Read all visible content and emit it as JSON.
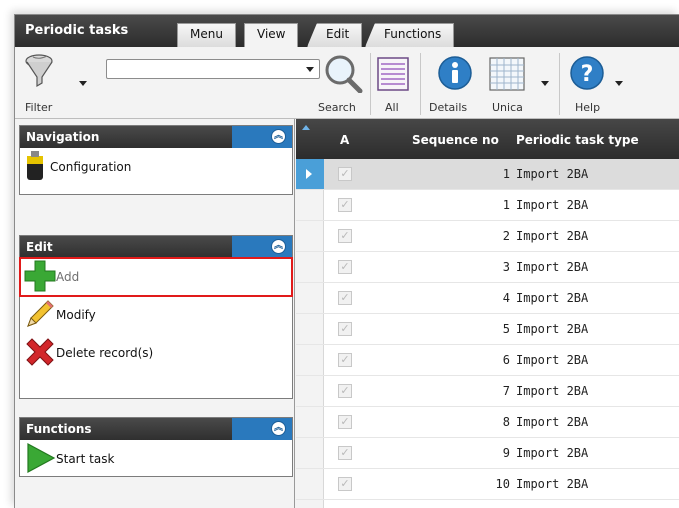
{
  "app_title": "Periodic tasks",
  "tabs": [
    {
      "label": "Menu",
      "active": false
    },
    {
      "label": "View",
      "active": true
    },
    {
      "label": "Edit",
      "active": false
    },
    {
      "label": "Functions",
      "active": false
    }
  ],
  "ribbon": {
    "filter_label": "Filter",
    "search_value": "",
    "search_label": "Search",
    "all_label": "All",
    "details_label": "Details",
    "unica_label": "Unica",
    "help_label": "Help"
  },
  "panels": {
    "navigation": {
      "title": "Navigation",
      "items": [
        {
          "label": "Configuration",
          "icon": "configuration-icon"
        }
      ]
    },
    "edit": {
      "title": "Edit",
      "items": [
        {
          "label": "Add",
          "icon": "add-icon"
        },
        {
          "label": "Modify",
          "icon": "pencil-icon"
        },
        {
          "label": "Delete record(s)",
          "icon": "delete-icon"
        }
      ]
    },
    "functions": {
      "title": "Functions",
      "items": [
        {
          "label": "Start task",
          "icon": "play-icon"
        }
      ]
    }
  },
  "grid": {
    "columns": [
      "A",
      "Sequence no",
      "Periodic task type"
    ],
    "rows": [
      {
        "seq": "1",
        "type": "Import 2BA"
      },
      {
        "seq": "1",
        "type": "Import 2BA"
      },
      {
        "seq": "2",
        "type": "Import 2BA"
      },
      {
        "seq": "3",
        "type": "Import 2BA"
      },
      {
        "seq": "4",
        "type": "Import 2BA"
      },
      {
        "seq": "5",
        "type": "Import 2BA"
      },
      {
        "seq": "6",
        "type": "Import 2BA"
      },
      {
        "seq": "7",
        "type": "Import 2BA"
      },
      {
        "seq": "8",
        "type": "Import 2BA"
      },
      {
        "seq": "9",
        "type": "Import 2BA"
      },
      {
        "seq": "10",
        "type": "Import 2BA"
      }
    ]
  },
  "colors": {
    "accent": "#2a79bd",
    "highlight_border": "#e11a1a",
    "header_dark": "#333333",
    "add_green": "#3aa835"
  }
}
